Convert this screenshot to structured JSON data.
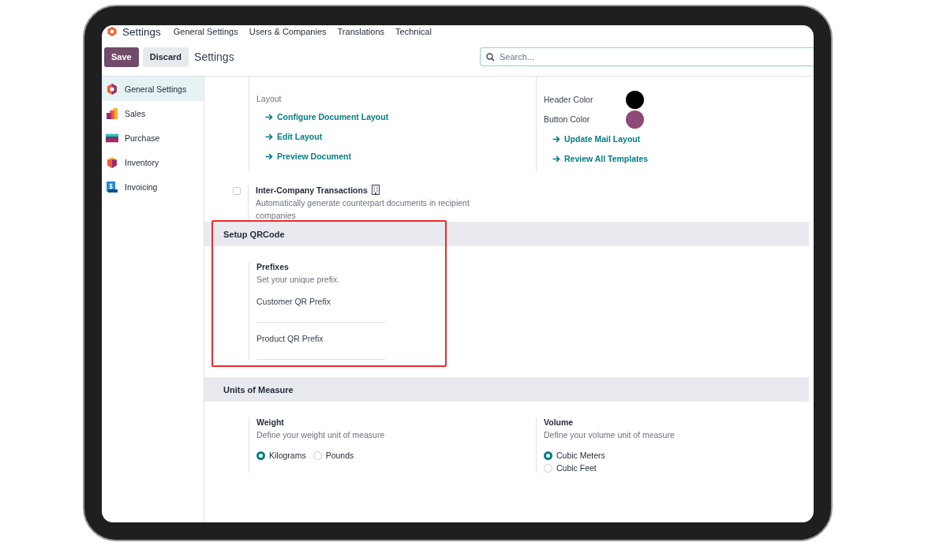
{
  "nav_menu": {
    "app_title": "Settings",
    "items": [
      "General Settings",
      "Users & Companies",
      "Translations",
      "Technical"
    ]
  },
  "control_panel": {
    "buttons": [
      {
        "label": "Save",
        "kind": "primary"
      },
      {
        "label": "Discard",
        "kind": "secondary"
      }
    ],
    "title": "Settings",
    "search": {
      "placeholder": "Search..."
    }
  },
  "sidebar": {
    "items": [
      {
        "label": "General Settings",
        "selected": true
      },
      {
        "label": "Sales",
        "selected": false
      },
      {
        "label": "Purchase",
        "selected": false
      },
      {
        "label": "Inventory",
        "selected": false
      },
      {
        "label": "Invoicing",
        "selected": false
      }
    ]
  },
  "document_layout": {
    "label": "Layout",
    "links": [
      "Configure Document Layout",
      "Edit Layout",
      "Preview Document"
    ]
  },
  "mail_layout": {
    "colors": [
      {
        "label": "Header Color",
        "color": "#000000"
      },
      {
        "label": "Button Color",
        "color": "#8e4a75"
      }
    ],
    "links": [
      "Update Mail Layout",
      "Review All Templates"
    ]
  },
  "inter_company": {
    "title": "Inter-Company Transactions",
    "description": "Automatically generate counterpart documents in recipient companies",
    "checked": false
  },
  "sections": [
    {
      "title": "Setup QRCode",
      "highlighted": true,
      "blocks": [
        {
          "kind": "fields",
          "title": "Prefixes",
          "description": "Set your unique prefix.",
          "fields": [
            {
              "label": "Customer QR Prefix"
            },
            {
              "label": "Product QR Prefix"
            }
          ]
        }
      ]
    },
    {
      "title": "Units of Measure",
      "highlighted": false,
      "blocks": [
        {
          "kind": "radiorow",
          "title": "Weight",
          "description": "Define your weight unit of measure",
          "options": [
            {
              "label": "Kilograms",
              "selected": true
            },
            {
              "label": "Pounds",
              "selected": false
            }
          ]
        },
        {
          "kind": "radiolist",
          "title": "Volume",
          "description": "Define your volume unit of measure",
          "options": [
            {
              "label": "Cubic Meters",
              "selected": true
            },
            {
              "label": "Cubic Feet",
              "selected": false
            }
          ]
        }
      ]
    }
  ]
}
